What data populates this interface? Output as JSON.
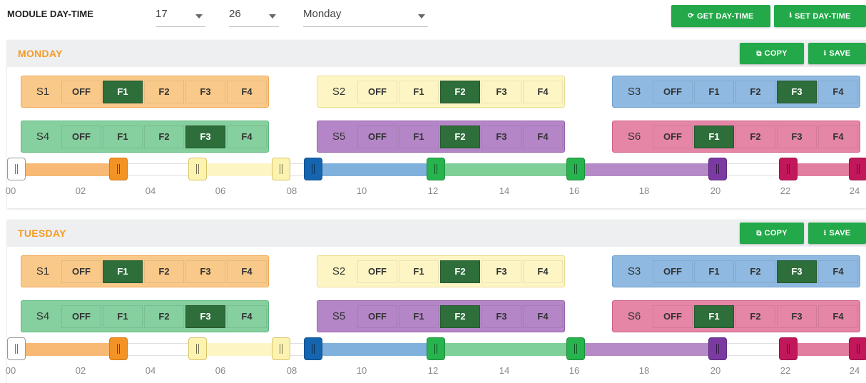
{
  "topbar": {
    "label": "MODULE DAY-TIME",
    "hour": "17",
    "minute": "26",
    "weekday": "Monday",
    "get_label": "GET DAY-TIME",
    "set_label": "SET DAY-TIME",
    "get_icon": "refresh-icon",
    "set_icon": "upload-icon"
  },
  "colors": {
    "accent": "#23a94a",
    "day_title": "#f59b22",
    "active_option": "#2d6e3a",
    "s1": "#f9c98a",
    "s2": "#fdf6c4",
    "s3": "#8fb9e0",
    "s4": "#86cf9f",
    "s5": "#b486c7",
    "s6": "#e586a6"
  },
  "days": [
    {
      "title": "MONDAY",
      "copy_label": "COPY",
      "save_label": "SAVE",
      "slots": [
        {
          "name": "S1",
          "options": [
            "OFF",
            "F1",
            "F2",
            "F3",
            "F4"
          ],
          "active": "F1"
        },
        {
          "name": "S2",
          "options": [
            "OFF",
            "F1",
            "F2",
            "F3",
            "F4"
          ],
          "active": "F2"
        },
        {
          "name": "S3",
          "options": [
            "OFF",
            "F1",
            "F2",
            "F3",
            "F4"
          ],
          "active": "F3"
        },
        {
          "name": "S4",
          "options": [
            "OFF",
            "F1",
            "F2",
            "F3",
            "F4"
          ],
          "active": "F3"
        },
        {
          "name": "S5",
          "options": [
            "OFF",
            "F1",
            "F2",
            "F3",
            "F4"
          ],
          "active": "F2"
        },
        {
          "name": "S6",
          "options": [
            "OFF",
            "F1",
            "F2",
            "F3",
            "F4"
          ],
          "active": "F1"
        }
      ],
      "ticks": [
        "00",
        "02",
        "04",
        "06",
        "08",
        "10",
        "12",
        "14",
        "16",
        "18",
        "20",
        "22",
        "24"
      ]
    },
    {
      "title": "TUESDAY",
      "copy_label": "COPY",
      "save_label": "SAVE",
      "slots": [
        {
          "name": "S1",
          "options": [
            "OFF",
            "F1",
            "F2",
            "F3",
            "F4"
          ],
          "active": "F1"
        },
        {
          "name": "S2",
          "options": [
            "OFF",
            "F1",
            "F2",
            "F3",
            "F4"
          ],
          "active": "F2"
        },
        {
          "name": "S3",
          "options": [
            "OFF",
            "F1",
            "F2",
            "F3",
            "F4"
          ],
          "active": "F3"
        },
        {
          "name": "S4",
          "options": [
            "OFF",
            "F1",
            "F2",
            "F3",
            "F4"
          ],
          "active": "F3"
        },
        {
          "name": "S5",
          "options": [
            "OFF",
            "F1",
            "F2",
            "F3",
            "F4"
          ],
          "active": "F2"
        },
        {
          "name": "S6",
          "options": [
            "OFF",
            "F1",
            "F2",
            "F3",
            "F4"
          ],
          "active": "F1"
        }
      ],
      "ticks": [
        "00",
        "02",
        "04",
        "06",
        "08",
        "10",
        "12",
        "14",
        "16",
        "18",
        "20",
        "22",
        "24"
      ]
    }
  ]
}
